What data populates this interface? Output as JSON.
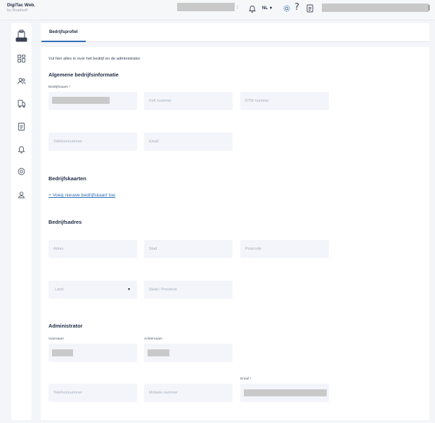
{
  "brand": {
    "title": "DigiTac Web.",
    "subtitle": "by Roadsoft"
  },
  "header": {
    "language": "NL",
    "language_caret": "▾",
    "help_symbol": "?",
    "separator": ":"
  },
  "colors": {
    "accent": "#2f6fb8",
    "field_bg": "#f3f5fa",
    "page_bg": "#f3f5f8",
    "redaction": "#c9c9c9"
  },
  "icons": {
    "top": [
      "bell-icon",
      "gear-icon",
      "help-icon",
      "document-icon"
    ],
    "sidebar": [
      "truck-icon",
      "dashboard-icon",
      "users-icon",
      "vehicle-icon",
      "report-icon",
      "notification-icon",
      "location-icon",
      "support-icon"
    ]
  },
  "tabs": [
    {
      "label": "Bedrijfsprofiel",
      "active": true
    }
  ],
  "intro": "Vul hier alles in over het bedrijf en de administrator.",
  "company": {
    "heading": "Algemene bedrijfsinformatie",
    "name_label": "Bedrijfsnaam *",
    "kvk_placeholder": "KvK nummer",
    "btw_placeholder": "BTW nummer",
    "phone_placeholder": "Telefoonnummer",
    "email_placeholder": "Email"
  },
  "cards": {
    "heading": "Bedrijfskaarten",
    "add_link": "+ Voeg nieuwe bedrijfskaart toe"
  },
  "address": {
    "heading": "Bedrijfsadres",
    "street_placeholder": "Adres",
    "city_placeholder": "Stad",
    "postcode_placeholder": "Postcode",
    "country_placeholder": "Land",
    "country_caret": "▾",
    "state_placeholder": "Staat / Provincie"
  },
  "admin": {
    "heading": "Administrator",
    "firstname_label": "Voornaam",
    "lastname_label": "Achternaam",
    "email_label": "Email *",
    "phone_placeholder": "Telefoonnummer",
    "mobile_placeholder": "Mobiele nummer"
  }
}
